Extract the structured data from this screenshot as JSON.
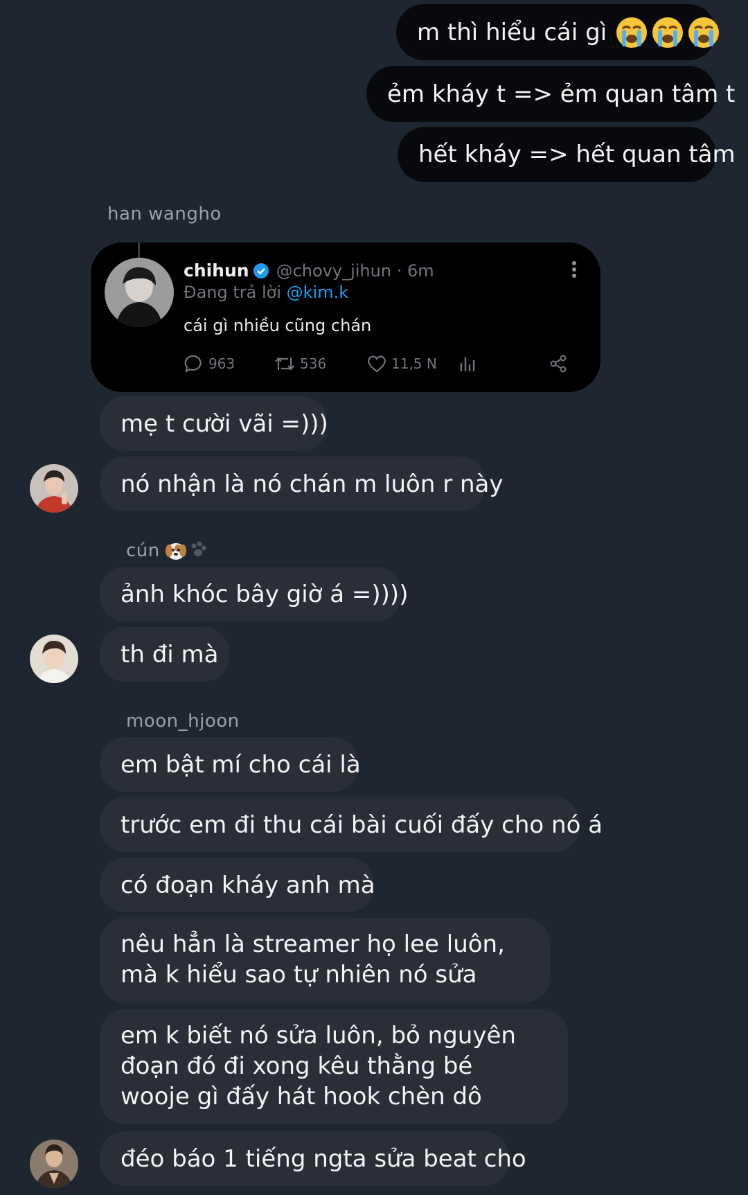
{
  "sent_messages": [
    {
      "text": "m thì hiểu cái gì",
      "emoji": "😭😭😭"
    },
    {
      "text": "ẻm kháy t => ẻm quan tâm t"
    },
    {
      "text": "hết kháy => hết quan tâm"
    }
  ],
  "groups": [
    {
      "sender": "han wangho",
      "tweet": {
        "name": "chihun",
        "verified": true,
        "handle": "@chovy_jihun · 6m",
        "reply_prefix": "Đang trả lời",
        "reply_mention": "@kim.k",
        "text": "cái gì nhiều cũng chán",
        "replies": "963",
        "retweets": "536",
        "likes": "11,5 N"
      },
      "messages": [
        "mẹ t cười vãi =)))",
        "nó nhận là nó chán m luôn r này"
      ]
    },
    {
      "sender": "cún",
      "sender_emoji": "🐶🐾",
      "messages": [
        "ảnh khóc bây giờ á =))))",
        "th đi mà"
      ]
    },
    {
      "sender": "moon_hjoon",
      "messages": [
        "em bật mí cho cái là",
        "trước em đi thu cái bài cuối đấy cho nó á",
        "có đoạn kháy anh mà",
        "nêu hẳn là streamer họ lee luôn, mà k hiểu sao tự nhiên nó sửa",
        "em k biết nó sửa luôn, bỏ nguyên đoạn đó đi xong kêu thằng bé wooje gì đấy hát hook chèn dô",
        "đéo báo 1 tiếng ngta sửa beat cho"
      ]
    }
  ],
  "colors": {
    "background": "#1d2631",
    "sent_bubble": "#08090c",
    "received_bubble": "#292e38",
    "mention": "#1d9bf0",
    "verified": "#1d9bf0"
  }
}
